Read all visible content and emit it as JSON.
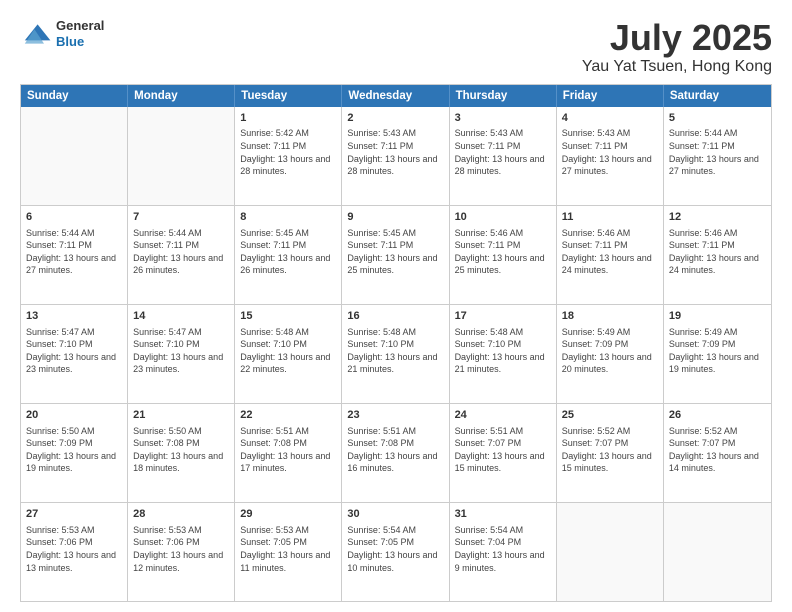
{
  "header": {
    "logo_line1": "General",
    "logo_line2": "Blue",
    "title": "July 2025",
    "subtitle": "Yau Yat Tsuen, Hong Kong"
  },
  "calendar": {
    "weekdays": [
      "Sunday",
      "Monday",
      "Tuesday",
      "Wednesday",
      "Thursday",
      "Friday",
      "Saturday"
    ],
    "weeks": [
      [
        {
          "day": "",
          "info": "",
          "empty": true
        },
        {
          "day": "",
          "info": "",
          "empty": true
        },
        {
          "day": "1",
          "info": "Sunrise: 5:42 AM\nSunset: 7:11 PM\nDaylight: 13 hours and 28 minutes."
        },
        {
          "day": "2",
          "info": "Sunrise: 5:43 AM\nSunset: 7:11 PM\nDaylight: 13 hours and 28 minutes."
        },
        {
          "day": "3",
          "info": "Sunrise: 5:43 AM\nSunset: 7:11 PM\nDaylight: 13 hours and 28 minutes."
        },
        {
          "day": "4",
          "info": "Sunrise: 5:43 AM\nSunset: 7:11 PM\nDaylight: 13 hours and 27 minutes."
        },
        {
          "day": "5",
          "info": "Sunrise: 5:44 AM\nSunset: 7:11 PM\nDaylight: 13 hours and 27 minutes."
        }
      ],
      [
        {
          "day": "6",
          "info": "Sunrise: 5:44 AM\nSunset: 7:11 PM\nDaylight: 13 hours and 27 minutes."
        },
        {
          "day": "7",
          "info": "Sunrise: 5:44 AM\nSunset: 7:11 PM\nDaylight: 13 hours and 26 minutes."
        },
        {
          "day": "8",
          "info": "Sunrise: 5:45 AM\nSunset: 7:11 PM\nDaylight: 13 hours and 26 minutes."
        },
        {
          "day": "9",
          "info": "Sunrise: 5:45 AM\nSunset: 7:11 PM\nDaylight: 13 hours and 25 minutes."
        },
        {
          "day": "10",
          "info": "Sunrise: 5:46 AM\nSunset: 7:11 PM\nDaylight: 13 hours and 25 minutes."
        },
        {
          "day": "11",
          "info": "Sunrise: 5:46 AM\nSunset: 7:11 PM\nDaylight: 13 hours and 24 minutes."
        },
        {
          "day": "12",
          "info": "Sunrise: 5:46 AM\nSunset: 7:11 PM\nDaylight: 13 hours and 24 minutes."
        }
      ],
      [
        {
          "day": "13",
          "info": "Sunrise: 5:47 AM\nSunset: 7:10 PM\nDaylight: 13 hours and 23 minutes."
        },
        {
          "day": "14",
          "info": "Sunrise: 5:47 AM\nSunset: 7:10 PM\nDaylight: 13 hours and 23 minutes."
        },
        {
          "day": "15",
          "info": "Sunrise: 5:48 AM\nSunset: 7:10 PM\nDaylight: 13 hours and 22 minutes."
        },
        {
          "day": "16",
          "info": "Sunrise: 5:48 AM\nSunset: 7:10 PM\nDaylight: 13 hours and 21 minutes."
        },
        {
          "day": "17",
          "info": "Sunrise: 5:48 AM\nSunset: 7:10 PM\nDaylight: 13 hours and 21 minutes."
        },
        {
          "day": "18",
          "info": "Sunrise: 5:49 AM\nSunset: 7:09 PM\nDaylight: 13 hours and 20 minutes."
        },
        {
          "day": "19",
          "info": "Sunrise: 5:49 AM\nSunset: 7:09 PM\nDaylight: 13 hours and 19 minutes."
        }
      ],
      [
        {
          "day": "20",
          "info": "Sunrise: 5:50 AM\nSunset: 7:09 PM\nDaylight: 13 hours and 19 minutes."
        },
        {
          "day": "21",
          "info": "Sunrise: 5:50 AM\nSunset: 7:08 PM\nDaylight: 13 hours and 18 minutes."
        },
        {
          "day": "22",
          "info": "Sunrise: 5:51 AM\nSunset: 7:08 PM\nDaylight: 13 hours and 17 minutes."
        },
        {
          "day": "23",
          "info": "Sunrise: 5:51 AM\nSunset: 7:08 PM\nDaylight: 13 hours and 16 minutes."
        },
        {
          "day": "24",
          "info": "Sunrise: 5:51 AM\nSunset: 7:07 PM\nDaylight: 13 hours and 15 minutes."
        },
        {
          "day": "25",
          "info": "Sunrise: 5:52 AM\nSunset: 7:07 PM\nDaylight: 13 hours and 15 minutes."
        },
        {
          "day": "26",
          "info": "Sunrise: 5:52 AM\nSunset: 7:07 PM\nDaylight: 13 hours and 14 minutes."
        }
      ],
      [
        {
          "day": "27",
          "info": "Sunrise: 5:53 AM\nSunset: 7:06 PM\nDaylight: 13 hours and 13 minutes."
        },
        {
          "day": "28",
          "info": "Sunrise: 5:53 AM\nSunset: 7:06 PM\nDaylight: 13 hours and 12 minutes."
        },
        {
          "day": "29",
          "info": "Sunrise: 5:53 AM\nSunset: 7:05 PM\nDaylight: 13 hours and 11 minutes."
        },
        {
          "day": "30",
          "info": "Sunrise: 5:54 AM\nSunset: 7:05 PM\nDaylight: 13 hours and 10 minutes."
        },
        {
          "day": "31",
          "info": "Sunrise: 5:54 AM\nSunset: 7:04 PM\nDaylight: 13 hours and 9 minutes."
        },
        {
          "day": "",
          "info": "",
          "empty": true
        },
        {
          "day": "",
          "info": "",
          "empty": true
        }
      ]
    ]
  }
}
